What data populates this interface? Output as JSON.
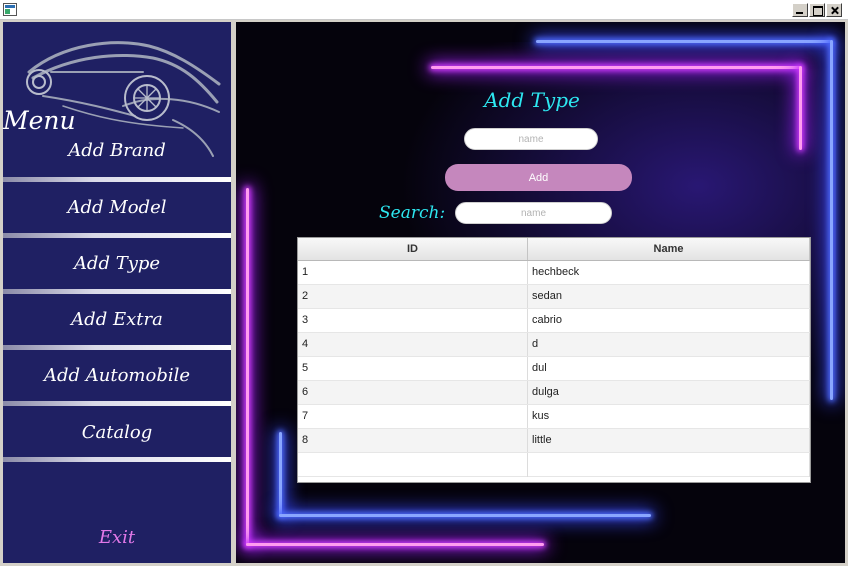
{
  "window": {
    "icon": "java-app-icon",
    "controls": [
      "minimize-icon",
      "maximize-icon",
      "close-icon"
    ]
  },
  "sidebar": {
    "logo": "sports-car-logo",
    "menu_label": "Menu",
    "items": [
      {
        "label": "Add Brand"
      },
      {
        "label": "Add Model"
      },
      {
        "label": "Add Type"
      },
      {
        "label": "Add Extra"
      },
      {
        "label": "Add Automobile"
      },
      {
        "label": "Catalog"
      }
    ],
    "exit_label": "Exit"
  },
  "form": {
    "title": "Add Type",
    "name_placeholder": "name",
    "name_value": "",
    "add_label": "Add",
    "search_label": "Search:",
    "search_placeholder": "name",
    "search_value": ""
  },
  "table": {
    "columns": [
      "ID",
      "Name"
    ],
    "rows": [
      {
        "id": "1",
        "name": "hechbeck"
      },
      {
        "id": "2",
        "name": "sedan"
      },
      {
        "id": "3",
        "name": "cabrio"
      },
      {
        "id": "4",
        "name": "d"
      },
      {
        "id": "5",
        "name": "dul"
      },
      {
        "id": "6",
        "name": "dulga"
      },
      {
        "id": "7",
        "name": "kus"
      },
      {
        "id": "8",
        "name": "little"
      }
    ]
  },
  "colors": {
    "sidebar_bg": "#1f2063",
    "accent_cyan": "#2de7f0",
    "add_button": "#c587bd",
    "exit_text": "#e178e8",
    "neon_pink": "#d23bff",
    "neon_blue": "#4f6cff"
  }
}
